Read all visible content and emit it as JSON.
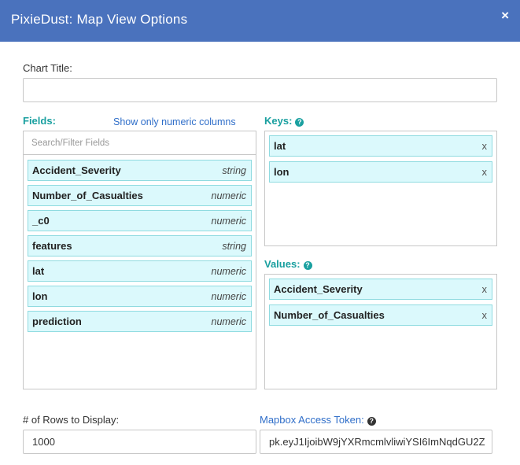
{
  "dialog": {
    "title": "PixieDust: Map View Options",
    "close_glyph": "×"
  },
  "chart_title": {
    "label": "Chart Title:",
    "value": ""
  },
  "fields": {
    "label": "Fields:",
    "numeric_toggle": "Show only numeric columns",
    "filter_placeholder": "Search/Filter Fields",
    "items": [
      {
        "name": "Accident_Severity",
        "type": "string"
      },
      {
        "name": "Number_of_Casualties",
        "type": "numeric"
      },
      {
        "name": "_c0",
        "type": "numeric"
      },
      {
        "name": "features",
        "type": "string"
      },
      {
        "name": "lat",
        "type": "numeric"
      },
      {
        "name": "lon",
        "type": "numeric"
      },
      {
        "name": "prediction",
        "type": "numeric"
      }
    ]
  },
  "keys": {
    "label": "Keys:",
    "help_glyph": "?",
    "items": [
      {
        "name": "lat",
        "remove": "x"
      },
      {
        "name": "lon",
        "remove": "x"
      }
    ]
  },
  "values": {
    "label": "Values:",
    "help_glyph": "?",
    "items": [
      {
        "name": "Accident_Severity",
        "remove": "x"
      },
      {
        "name": "Number_of_Casualties",
        "remove": "x"
      }
    ]
  },
  "rows": {
    "label": "# of Rows to Display:",
    "value": "1000"
  },
  "mapbox": {
    "label": "Mapbox Access Token:",
    "help_glyph": "?",
    "value": "pk.eyJ1IjoibW9jYXRmcmlvliwiYSI6ImNqdGU2Z"
  },
  "colors": {
    "header_bg": "#4a72bd",
    "accent_teal": "#1aa0a0",
    "chip_bg": "#dbf9fc",
    "link": "#2f6ec9"
  },
  "icons": {
    "close": "close-icon",
    "help": "question-circle-icon"
  }
}
